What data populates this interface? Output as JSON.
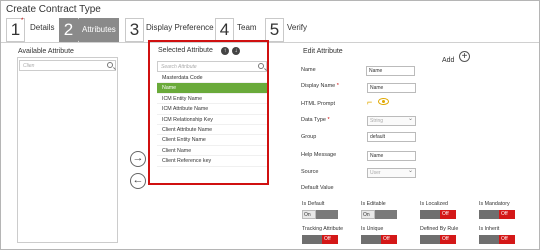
{
  "window": {
    "title": "Create Contract Type"
  },
  "steps": [
    {
      "num": "1",
      "label": "Details"
    },
    {
      "num": "2",
      "label": "Attributes"
    },
    {
      "num": "3",
      "label": "Display Preference"
    },
    {
      "num": "4",
      "label": "Team"
    },
    {
      "num": "5",
      "label": "Verify"
    }
  ],
  "available": {
    "title": "Available Attribute",
    "search_placeholder": "Clien"
  },
  "selected": {
    "title": "Selected Attribute",
    "search_placeholder": "Search Attribute",
    "items": [
      "Masterdata Code",
      "Name",
      "ICM Entity Name",
      "ICM Attribute Name",
      "ICM Relationship Key",
      "Client Attribute Name",
      "Client Entity Name",
      "Client Name",
      "Client Reference key"
    ],
    "active_index": 1
  },
  "transfer": {
    "right": "→",
    "left": "←"
  },
  "edit": {
    "title": "Edit  Attribute",
    "add_label": "Add",
    "fields": {
      "name": {
        "label": "Name",
        "value": "Name"
      },
      "display_name": {
        "label": "Display Name",
        "value": "Name"
      },
      "html_prompt": {
        "label": "HTML Prompt"
      },
      "data_type": {
        "label": "Data Type",
        "value": "String"
      },
      "group": {
        "label": "Group",
        "value": "default"
      },
      "help_message": {
        "label": "Help Message",
        "value": "Name"
      },
      "source": {
        "label": "Source",
        "value": "User"
      },
      "default_value": {
        "label": "Default Value"
      }
    },
    "toggles": [
      {
        "label": "Is Default",
        "state": "On"
      },
      {
        "label": "Is Editable",
        "state": "On"
      },
      {
        "label": "Is Localized",
        "state": "Off"
      },
      {
        "label": "Is Mandatory",
        "state": "Off"
      },
      {
        "label": "Tracking Attribute",
        "state": "Off"
      },
      {
        "label": "Is Unique",
        "state": "Off"
      },
      {
        "label": "Defined By Rule",
        "state": "Off"
      },
      {
        "label": "Is Inherit",
        "state": "Off"
      }
    ]
  },
  "colors": {
    "accent_green": "#6aaa3a",
    "highlight_red": "#d01010",
    "toggle_off_red": "#d41818",
    "icon_amber": "#e0a800"
  }
}
